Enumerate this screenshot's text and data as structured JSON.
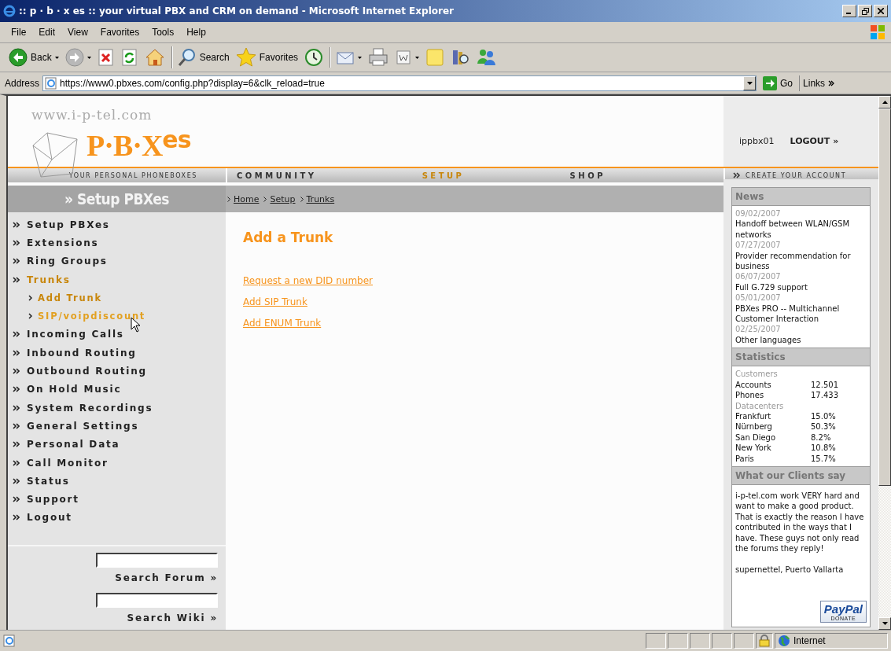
{
  "window": {
    "title": ":: p · b · x es :: your virtual PBX and CRM on demand - Microsoft Internet Explorer"
  },
  "menu": [
    "File",
    "Edit",
    "View",
    "Favorites",
    "Tools",
    "Help"
  ],
  "toolbar": [
    {
      "kind": "back",
      "label": "Back",
      "dropdown": true,
      "separator_before": false
    },
    {
      "kind": "forward",
      "dropdown": true,
      "separator_before": false
    },
    {
      "kind": "stop",
      "dropdown": false,
      "separator_before": false
    },
    {
      "kind": "refresh",
      "dropdown": false,
      "separator_before": false
    },
    {
      "kind": "home",
      "dropdown": false,
      "separator_before": false
    },
    {
      "kind": "search",
      "label": "Search",
      "dropdown": false,
      "separator_before": true
    },
    {
      "kind": "favorites",
      "label": "Favorites",
      "dropdown": false,
      "separator_before": false
    },
    {
      "kind": "history",
      "dropdown": false,
      "separator_before": false
    },
    {
      "kind": "mail",
      "dropdown": true,
      "separator_before": true
    },
    {
      "kind": "print",
      "dropdown": false,
      "separator_before": false
    },
    {
      "kind": "edit",
      "dropdown": true,
      "separator_before": false
    },
    {
      "kind": "note",
      "dropdown": false,
      "separator_before": false
    },
    {
      "kind": "research",
      "dropdown": false,
      "separator_before": false
    },
    {
      "kind": "messenger",
      "dropdown": false,
      "separator_before": false
    }
  ],
  "address": {
    "label": "Address",
    "url": "https://www0.pbxes.com/config.php?display=6&clk_reload=true",
    "go": "Go",
    "links": "Links"
  },
  "site": {
    "domain": "www.i-p-tel.com",
    "logo": "P·B·X$^{es}$",
    "tagline": "YOUR PERSONAL PHONEBOXES",
    "user": "ippbx01",
    "logout": "LOGOUT »",
    "create_account": "CREATE YOUR ACCOUNT"
  },
  "nav": [
    {
      "label": "COMMUNITY",
      "selected": false
    },
    {
      "label": "SETUP",
      "selected": true
    },
    {
      "label": "SHOP",
      "selected": false
    }
  ],
  "sidebar": {
    "title": "» Setup PBXes",
    "items": [
      {
        "label": "Setup PBXes",
        "selected": false
      },
      {
        "label": "Extensions",
        "selected": false
      },
      {
        "label": "Ring Groups",
        "selected": false
      },
      {
        "label": "Trunks",
        "selected": true,
        "children": [
          {
            "label": "Add Trunk",
            "selected": true
          },
          {
            "label": "SIP/voipdiscount",
            "selected": false
          }
        ]
      },
      {
        "label": "Incoming Calls",
        "selected": false
      },
      {
        "label": "Inbound Routing",
        "selected": false
      },
      {
        "label": "Outbound Routing",
        "selected": false
      },
      {
        "label": "On Hold Music",
        "selected": false
      },
      {
        "label": "System Recordings",
        "selected": false
      },
      {
        "label": "General Settings",
        "selected": false
      },
      {
        "label": "Personal Data",
        "selected": false
      },
      {
        "label": "Call Monitor",
        "selected": false
      },
      {
        "label": "Status",
        "selected": false
      },
      {
        "label": "Support",
        "selected": false
      },
      {
        "label": "Logout",
        "selected": false
      }
    ],
    "searches": [
      "Search Forum »",
      "Search Wiki »"
    ]
  },
  "breadcrumb": [
    "Home",
    "Setup",
    "Trunks"
  ],
  "content": {
    "title": "Add a Trunk",
    "links": [
      "Request a new DID number",
      "Add SIP Trunk",
      "Add ENUM Trunk"
    ]
  },
  "news": {
    "title": "News",
    "items": [
      {
        "date": "09/02/2007",
        "text": "Handoff between WLAN/GSM networks"
      },
      {
        "date": "07/27/2007",
        "text": "Provider recommendation for business"
      },
      {
        "date": "06/07/2007",
        "text": "Full G.729 support"
      },
      {
        "date": "05/01/2007",
        "text": "PBXes PRO -- Multichannel Customer Interaction"
      },
      {
        "date": "02/25/2007",
        "text": "Other languages"
      }
    ]
  },
  "statistics": {
    "title": "Statistics",
    "groups": [
      {
        "heading": "Customers",
        "rows": [
          {
            "label": "Accounts",
            "value": "12.501"
          },
          {
            "label": "Phones",
            "value": "17.433"
          }
        ]
      },
      {
        "heading": "Datacenters",
        "rows": [
          {
            "label": "Frankfurt",
            "value": "15.0%"
          },
          {
            "label": "Nürnberg",
            "value": "50.3%"
          },
          {
            "label": "San Diego",
            "value": "8.2%"
          },
          {
            "label": "New York",
            "value": "10.8%"
          },
          {
            "label": "Paris",
            "value": "15.7%"
          }
        ]
      }
    ]
  },
  "clients": {
    "title": "What our Clients say",
    "quote": "i-p-tel.com work VERY hard and want to make a good product. That is exactly the reason I have contributed in the ways that I have. These guys not only read the forums they reply!",
    "author": "supernettel, Puerto Vallarta",
    "donate": {
      "brand": "PayPal",
      "label": "DONATE"
    }
  },
  "status_bar": {
    "zone": "Internet"
  }
}
